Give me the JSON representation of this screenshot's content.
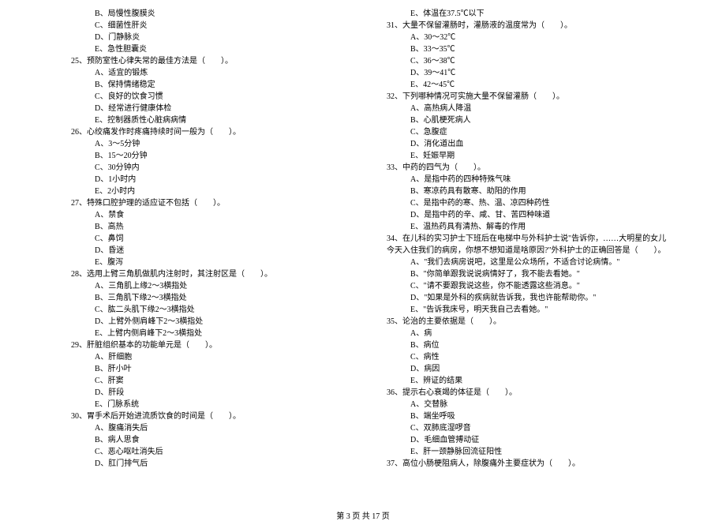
{
  "left": {
    "opts24": [
      "B、局慢性腹膜炎",
      "C、细菌性肝炎",
      "D、门静脉炎",
      "E、急性胆囊炎"
    ],
    "q25": "25、预防室性心律失常的最佳方法是（　　）。",
    "opts25": [
      "A、适宜的锻炼",
      "B、保持情绪稳定",
      "C、良好的饮食习惯",
      "D、经常进行健康体检",
      "E、控制器质性心脏病病情"
    ],
    "q26": "26、心绞痛发作时疼痛持续时间一般为（　　）。",
    "opts26": [
      "A、3～5分钟",
      "B、15～20分钟",
      "C、30分钟内",
      "D、1小时内",
      "E、2小时内"
    ],
    "q27": "27、特殊口腔护理的适应证不包括（　　）。",
    "opts27": [
      "A、禁食",
      "B、高热",
      "C、鼻饲",
      "D、昏迷",
      "E、腹泻"
    ],
    "q28": "28、选用上臂三角肌做肌内注射时，其注射区是（　　）。",
    "opts28": [
      "A、三角肌上缘2～3横指处",
      "B、三角肌下缘2～3横指处",
      "C、肱二头肌下缘2～3横指处",
      "D、上臂外侧肩峰下2～3横指处",
      "E、上臂内侧肩峰下2～3横指处"
    ],
    "q29": "29、肝脏组织基本的功能单元是（　　）。",
    "opts29": [
      "A、肝细胞",
      "B、肝小叶",
      "C、肝窦",
      "D、肝段",
      "E、门脉系统"
    ],
    "q30": "30、胃手术后开始进流质饮食的时间是（　　）。",
    "opts30": [
      "A、腹痛消失后",
      "B、病人思食",
      "C、恶心呕吐消失后",
      "D、肛门排气后"
    ]
  },
  "right": {
    "opt30e": "E、体温在37.5℃以下",
    "q31": "31、大量不保留灌肠时，灌肠液的温度常为（　　）。",
    "opts31": [
      "A、30～32℃",
      "B、33～35℃",
      "C、36～38℃",
      "D、39～41℃",
      "E、42～45℃"
    ],
    "q32": "32、下列哪种情况可实施大量不保留灌肠（　　）。",
    "opts32": [
      "A、高热病人降温",
      "B、心肌梗死病人",
      "C、急腹症",
      "D、消化道出血",
      "E、妊娠早期"
    ],
    "q33": "33、中药的四气为（　　）。",
    "opts33": [
      "A、是指中药的四种特殊气味",
      "B、寒凉药具有散寒、助阳的作用",
      "C、是指中药的寒、热、温、凉四种药性",
      "D、是指中药的辛、咸、甘、苦四种味道",
      "E、温热药具有清热、解毒的作用"
    ],
    "q34": "34、在儿科的实习护士下班后在电梯中与外科护士说\"告诉你，……大明星的女儿今天入住我们的病房，你想不想知道是啥原因?\"外科护士的正确回答是（　　）。",
    "opts34": [
      "A、\"我们去病房说吧，这里是公众场所，不适合讨论病情。\"",
      "B、\"你简单跟我说说病情好了，我不能去看她。\"",
      "C、\"请不要跟我说这些，你不能透露这些消息。\"",
      "D、\"如果是外科的疾病就告诉我，我也许能帮助你。\"",
      "E、\"告诉我床号，明天我自己去看她。\""
    ],
    "q35": "35、论治的主要依据是（　　）。",
    "opts35": [
      "A、病",
      "B、病位",
      "C、病性",
      "D、病因",
      "E、辨证的结果"
    ],
    "q36": "36、提示右心衰竭的体征是（　　）。",
    "opts36": [
      "A、交替脉",
      "B、端坐呼吸",
      "C、双肺底湿啰音",
      "D、毛细血管搏动征",
      "E、肝一颈静脉回流征阳性"
    ],
    "q37": "37、高位小肠梗阻病人，除腹痛外主要症状为（　　）。"
  },
  "footer": "第 3 页 共 17 页"
}
